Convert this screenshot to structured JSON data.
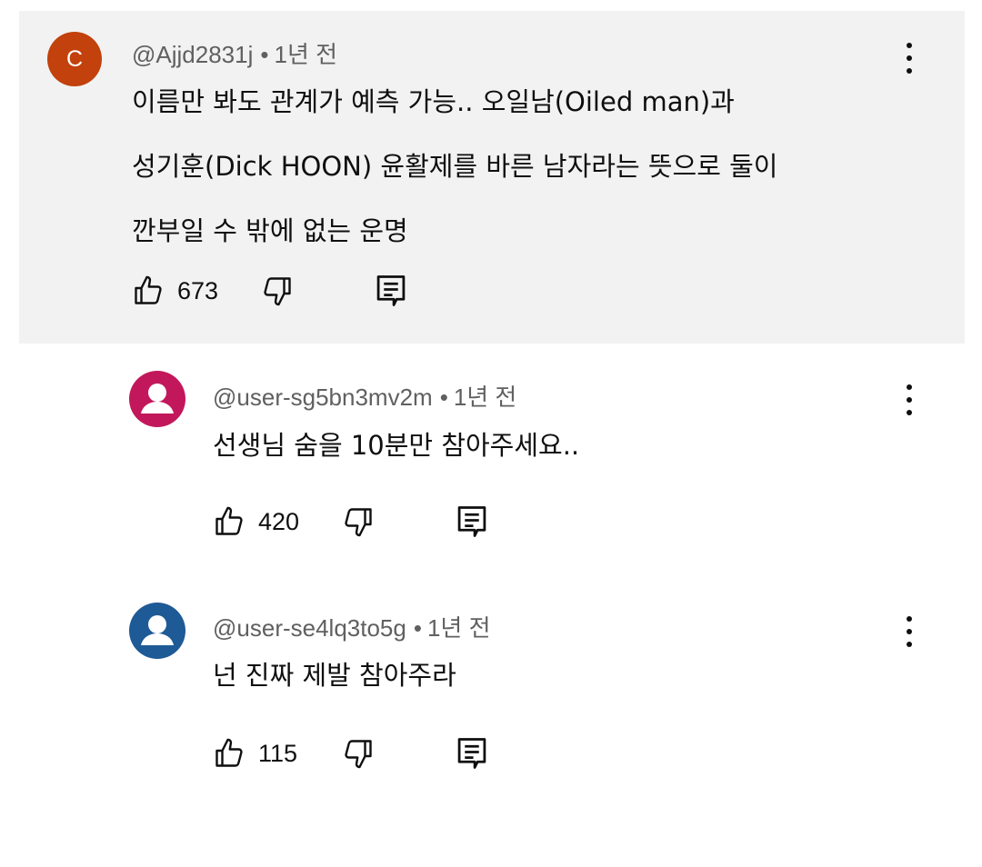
{
  "comments": [
    {
      "avatar_letter": "C",
      "avatar_color": "#c2410c",
      "handle": "@Ajjd2831j",
      "separator": "•",
      "time": "1년 전",
      "lines": [
        "이름만 봐도 관계가 예측 가능.. 오일남(Oiled man)과",
        "성기훈(Dick HOON) 윤활제를 바른 남자라는 뜻으로 둘이",
        "깐부일 수 밖에 없는 운명"
      ],
      "likes": "673",
      "highlighted": true
    },
    {
      "avatar_icon": "person-icon",
      "avatar_color": "#c2185b",
      "handle": "@user-sg5bn3mv2m",
      "separator": "•",
      "time": "1년 전",
      "lines": [
        "선생님 숨을 10분만 참아주세요.."
      ],
      "likes": "420"
    },
    {
      "avatar_icon": "person-icon",
      "avatar_color": "#1e5a96",
      "handle": "@user-se4lq3to5g",
      "separator": "•",
      "time": "1년 전",
      "lines": [
        "넌 진짜 제발 참아주라"
      ],
      "likes": "115"
    }
  ],
  "icons": {
    "like": "thumb-up-icon",
    "dislike": "thumb-down-icon",
    "reply": "comment-icon",
    "more": "more-vert-icon"
  }
}
